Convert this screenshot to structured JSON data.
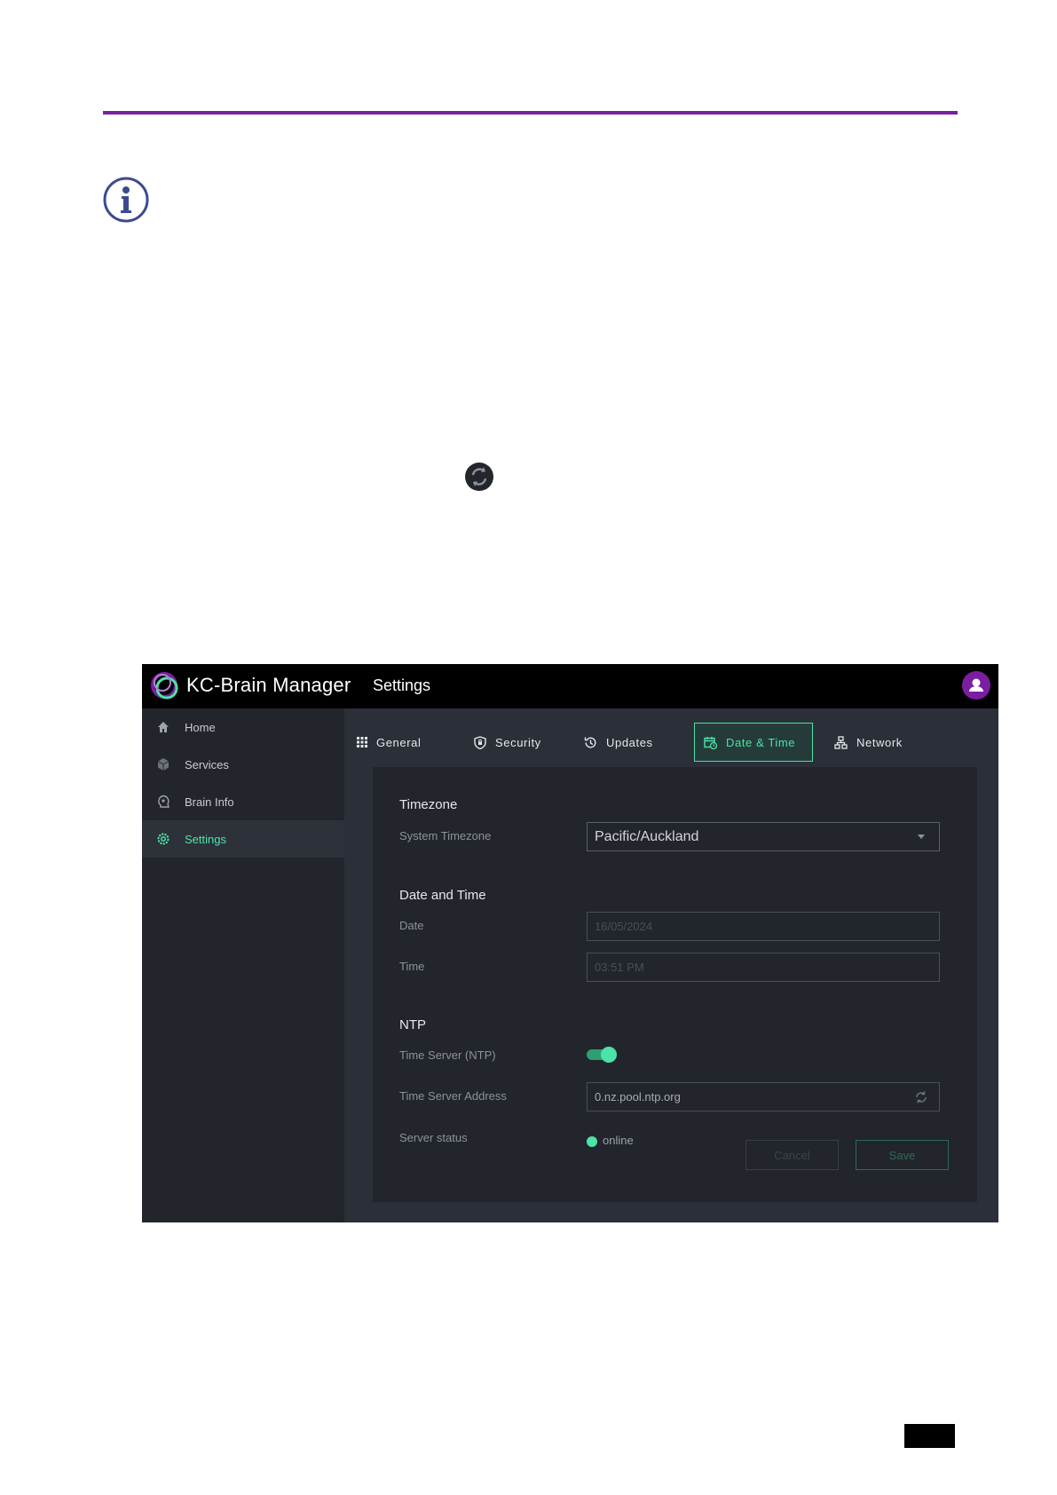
{
  "app": {
    "title": "KC-Brain Manager",
    "page_title": "Settings",
    "accent_color": "#4ce3a6",
    "brand_color": "#7b1fa2"
  },
  "sidebar": {
    "items": [
      {
        "label": "Home",
        "icon": "home-icon",
        "active": false
      },
      {
        "label": "Services",
        "icon": "cube-icon",
        "active": false
      },
      {
        "label": "Brain Info",
        "icon": "brain-icon",
        "active": false
      },
      {
        "label": "Settings",
        "icon": "gear-icon",
        "active": true
      }
    ]
  },
  "tabs": [
    {
      "label": "General",
      "icon": "grid-icon",
      "active": false
    },
    {
      "label": "Security",
      "icon": "shield-icon",
      "active": false
    },
    {
      "label": "Updates",
      "icon": "update-icon",
      "active": false
    },
    {
      "label": "Date & Time",
      "icon": "calendar-clock-icon",
      "active": true
    },
    {
      "label": "Network",
      "icon": "network-icon",
      "active": false
    }
  ],
  "timezone": {
    "section_title": "Timezone",
    "label": "System Timezone",
    "value": "Pacific/Auckland"
  },
  "date_time": {
    "section_title": "Date and Time",
    "date_label": "Date",
    "date_value": "16/05/2024",
    "time_label": "Time",
    "time_value": "03:51 PM"
  },
  "ntp": {
    "section_title": "NTP",
    "toggle_label": "Time Server (NTP)",
    "toggle_on": true,
    "address_label": "Time Server Address",
    "address_value": "0.nz.pool.ntp.org",
    "status_label": "Server status",
    "status_value": "online"
  },
  "actions": {
    "cancel_label": "Cancel",
    "save_label": "Save"
  }
}
